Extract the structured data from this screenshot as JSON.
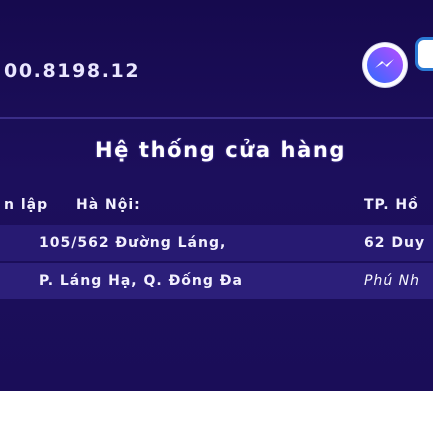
{
  "contact": {
    "phone": "00.8198.12"
  },
  "store_section": {
    "title": "Hệ thống cửa hàng",
    "rows": [
      {
        "col_a": "n lập",
        "col_b": "Hà Nội:",
        "col_right": "TP. Hồ"
      },
      {
        "col_main": "105/562 Đường Láng,",
        "col_right": "62 Duy"
      },
      {
        "col_main": "P. Láng Hạ, Q. Đống Đa",
        "col_right": "Phú Nh"
      }
    ]
  },
  "icons": {
    "messenger": "messenger-icon",
    "zalo": "zalo-icon"
  },
  "colors": {
    "panel_bg": "#1c0f5c",
    "messenger_gradient": [
      "#3b5bff",
      "#b84cff"
    ],
    "zalo_blue": "#2a7ad4"
  }
}
